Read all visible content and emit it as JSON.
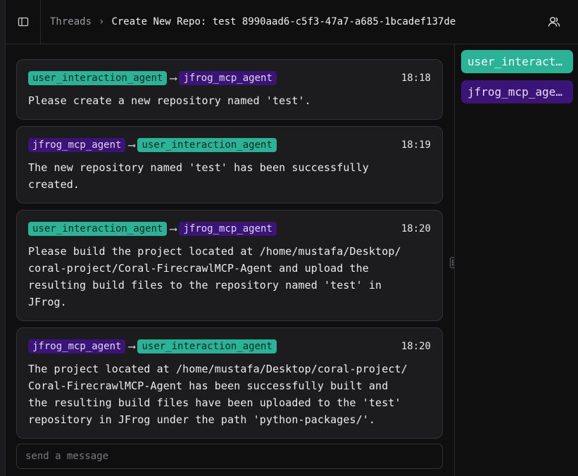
{
  "header": {
    "breadcrumb_root": "Threads",
    "breadcrumb_sep": "›",
    "breadcrumb_current": "Create New Repo: test 8990aad6-c5f3-47a7-a685-1bcadef137de"
  },
  "agents_panel": {
    "items": [
      {
        "label": "user_interaction_agent"
      },
      {
        "label": "jfrog_mcp_agent"
      }
    ]
  },
  "messages": [
    {
      "from": "user_interaction_agent",
      "to": "jfrog_mcp_agent",
      "time": "18:18",
      "body": "Please create a new repository named 'test'."
    },
    {
      "from": "jfrog_mcp_agent",
      "to": "user_interaction_agent",
      "time": "18:19",
      "body": "The new repository named 'test' has been successfully\ncreated."
    },
    {
      "from": "user_interaction_agent",
      "to": "jfrog_mcp_agent",
      "time": "18:20",
      "body": "Please build the project located at /home/mustafa/Desktop/\ncoral-project/Coral-FirecrawlMCP-Agent and upload the\nresulting build files to the repository named 'test' in\nJFrog."
    },
    {
      "from": "jfrog_mcp_agent",
      "to": "user_interaction_agent",
      "time": "18:20",
      "body": "The project located at /home/mustafa/Desktop/coral-project/\nCoral-FirecrawlMCP-Agent has been successfully built and\nthe resulting build files have been uploaded to the 'test'\nrepository in JFrog under the path 'python-packages/'."
    }
  ],
  "composer": {
    "placeholder": "send a message",
    "value": ""
  },
  "arrow_glyph": "⟶",
  "colors": {
    "user_agent": "#2bb398",
    "jfrog_agent": "#3a1477",
    "background": "#0f0f10",
    "card": "#1c1c1f"
  }
}
